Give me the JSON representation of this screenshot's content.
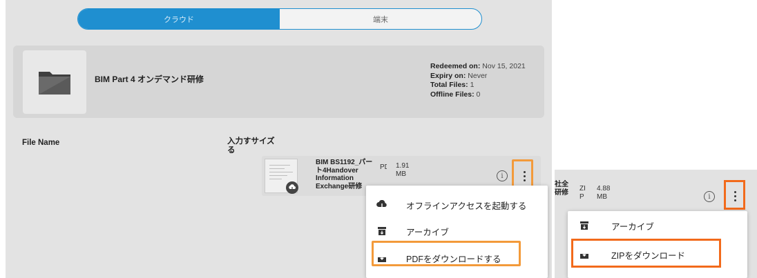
{
  "tabs": [
    {
      "label": "クラウド",
      "active": true
    },
    {
      "label": "端末",
      "active": false
    }
  ],
  "course": {
    "title": "BIM Part 4 オンデマンド研修",
    "icon": "folder-icon",
    "redeemed_label": "Redeemed on:",
    "redeemed_value": "Nov 15, 2021",
    "expiry_label": "Expiry on:",
    "expiry_value": "Never",
    "total_label": "Total Files:",
    "total_value": "1",
    "offline_label": "Offline Files:",
    "offline_value": "0"
  },
  "columns": {
    "file_name": "File Name",
    "input_size": "入力すサイズる"
  },
  "file": {
    "name": "BIM BS1192_パート4Handover Information Exchange研修",
    "type": "PDF",
    "size": "1.91 MB",
    "thumb_icon": "cloud-download-icon",
    "info_icon": "info-icon",
    "menu_icon": "more-vert-icon"
  },
  "pdf_menu": {
    "items": [
      {
        "label": "オフラインアクセスを起動する",
        "icon": "cloud-download-icon"
      },
      {
        "label": "アーカイブ",
        "icon": "archive-icon"
      },
      {
        "label": "PDFをダウンロードする",
        "icon": "download-icon"
      }
    ]
  },
  "zip_view": {
    "name_fragment_1": "社全",
    "name_fragment_2": "研修",
    "type_line1": "ZI",
    "type_line2": "P",
    "size_line1": "4.88",
    "size_line2": "MB",
    "menu": {
      "items": [
        {
          "label": "アーカイブ",
          "icon": "archive-icon"
        },
        {
          "label": "ZIPをダウンロード",
          "icon": "download-icon"
        }
      ]
    }
  },
  "colors": {
    "accent": "#1f8fd0",
    "highlight_orange": "#f39a3a",
    "highlight_red": "#f26a1b"
  }
}
